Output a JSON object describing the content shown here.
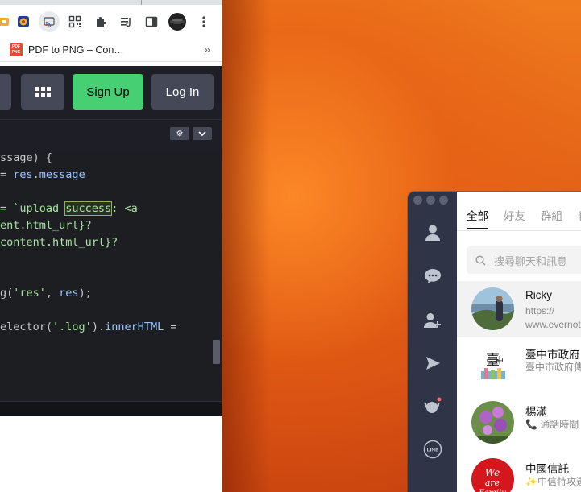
{
  "browser": {
    "bookmark": {
      "label": "PDF to PNG – Con…",
      "favicon_text": "PDF PNG"
    },
    "more_bookmarks": "»",
    "toolbar_icons": [
      "extension-icon-1",
      "extension-icon-2",
      "cast-icon",
      "qr-code-icon",
      "extensions-puzzle-icon",
      "reading-list-icon",
      "side-panel-icon",
      "profile-avatar",
      "more-menu-icon"
    ]
  },
  "site_header": {
    "signup_label": "Sign Up",
    "login_label": "Log In",
    "signup_color": "#47cf73"
  },
  "editor": {
    "lines": [
      {
        "p1": "ssage) {"
      },
      {
        "p1": "= ",
        "p2": "res",
        "p3": ".",
        "p4": "message"
      },
      {
        "p1": ""
      },
      {
        "p1": "= `upload ",
        "hl": "success",
        "p3": ": <a"
      },
      {
        "p1": "ent.html_url}?"
      },
      {
        "p1": "content.html_url}?"
      },
      {
        "p1": ""
      },
      {
        "p1": ""
      },
      {
        "p1": "g(",
        "s1": "'res'",
        "p3": ", ",
        "p4": "res",
        "p5": ");"
      },
      {
        "p1": ""
      },
      {
        "p1": "elector(",
        "s1": "'.log'",
        "p3": ").",
        "p4": "innerHTML",
        "p5": " ="
      }
    ]
  },
  "line_app": {
    "tabs": [
      "全部",
      "好友",
      "群組",
      "官"
    ],
    "active_tab": "全部",
    "search_placeholder": "搜尋聊天和訊息",
    "sidebar_icons": [
      "friends-icon",
      "chats-icon",
      "add-friend-icon",
      "keep-icon",
      "notifications-icon",
      "line-logo-icon"
    ],
    "chats": [
      {
        "name": "Ricky",
        "msg_line1": "https://",
        "msg_line2": "www.evernot"
      },
      {
        "name": "臺中市政府",
        "msg_line1": "臺中市政府傳"
      },
      {
        "name": "楊滿",
        "msg_line1": "📞 通話時間"
      },
      {
        "name": "中國信託",
        "msg_line1": "✨中信特攻透"
      }
    ]
  }
}
